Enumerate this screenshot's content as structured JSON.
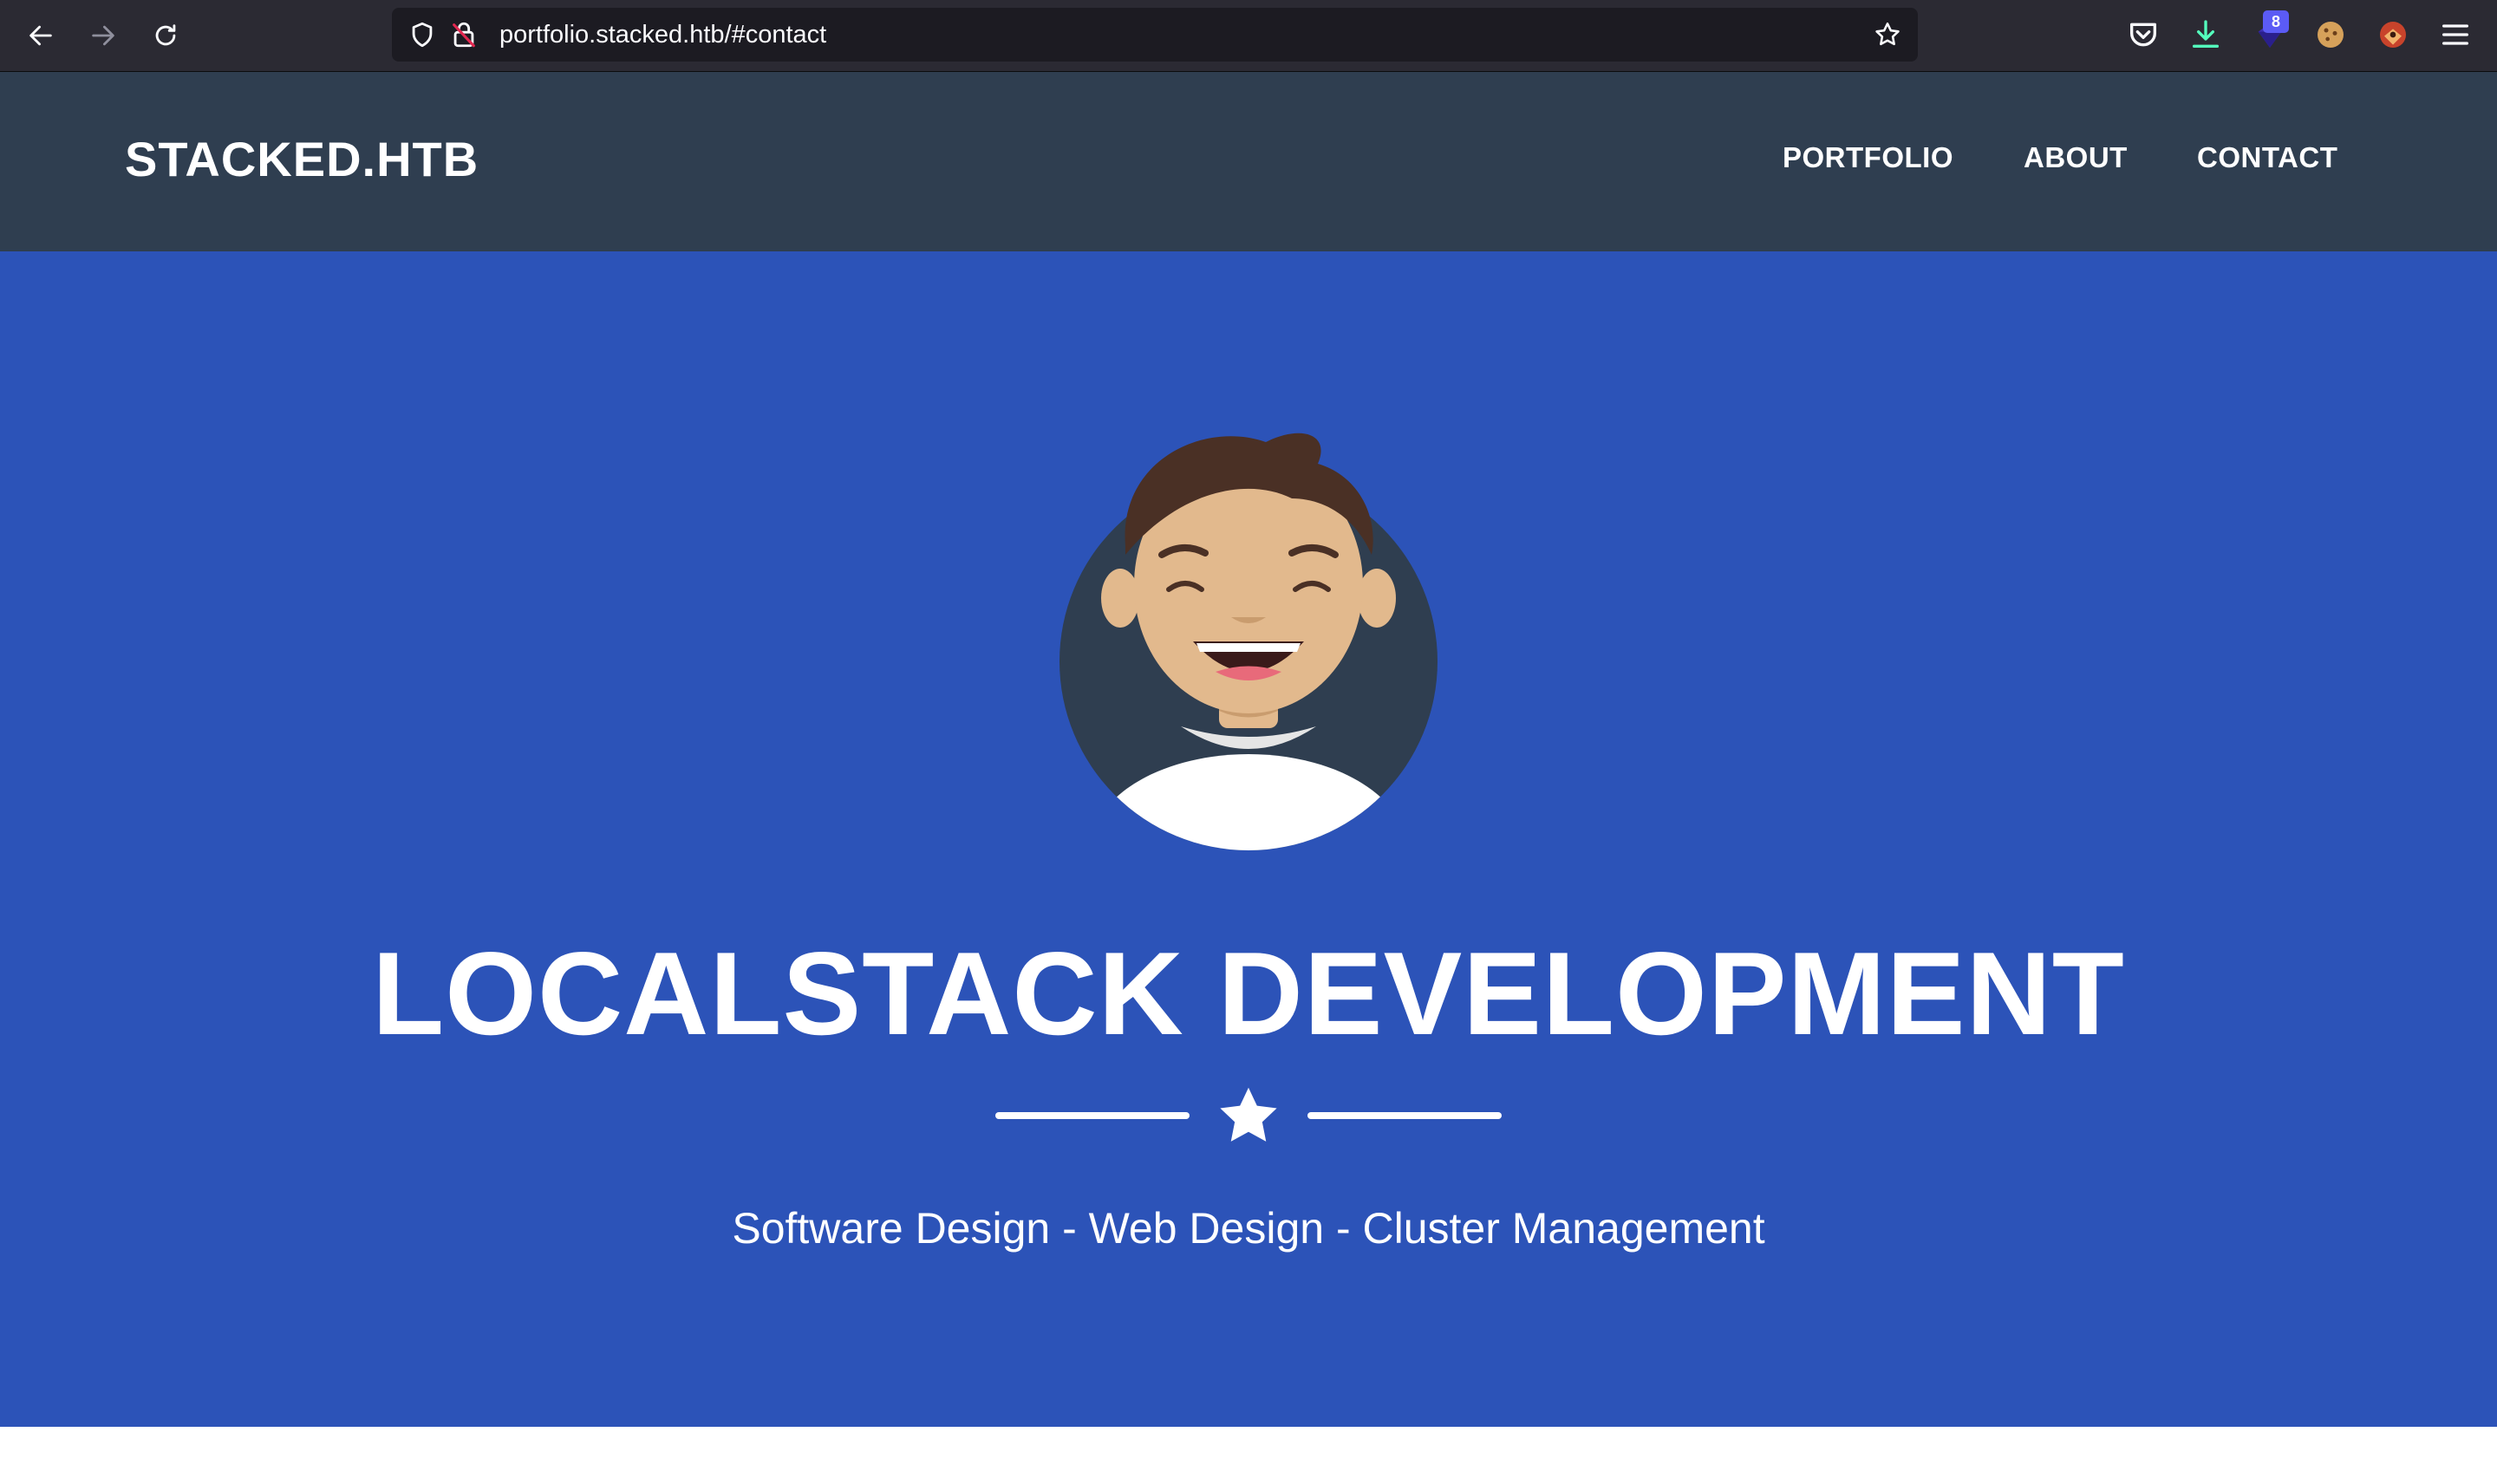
{
  "browser": {
    "url": "portfolio.stacked.htb/#contact",
    "extension_badge_count": "8"
  },
  "site": {
    "brand": "STACKED.HTB",
    "menu": [
      "PORTFOLIO",
      "ABOUT",
      "CONTACT"
    ]
  },
  "hero": {
    "title": "LOCALSTACK DEVELOPMENT",
    "subtitle": "Software Design - Web Design - Cluster Management"
  },
  "icons": {
    "back": "arrow-left-icon",
    "forward": "arrow-right-icon",
    "reload": "reload-icon",
    "tracking": "shield-icon",
    "insecure": "insecure-lock-icon",
    "bookmark": "star-outline-icon",
    "pocket": "pocket-icon",
    "downloads": "download-icon",
    "divider": "star-icon",
    "menu": "hamburger-menu-icon"
  },
  "colors": {
    "chrome": "#2b2a33",
    "navbar": "#2f3e50",
    "hero": "#2c53b8",
    "text": "#ffffff"
  }
}
